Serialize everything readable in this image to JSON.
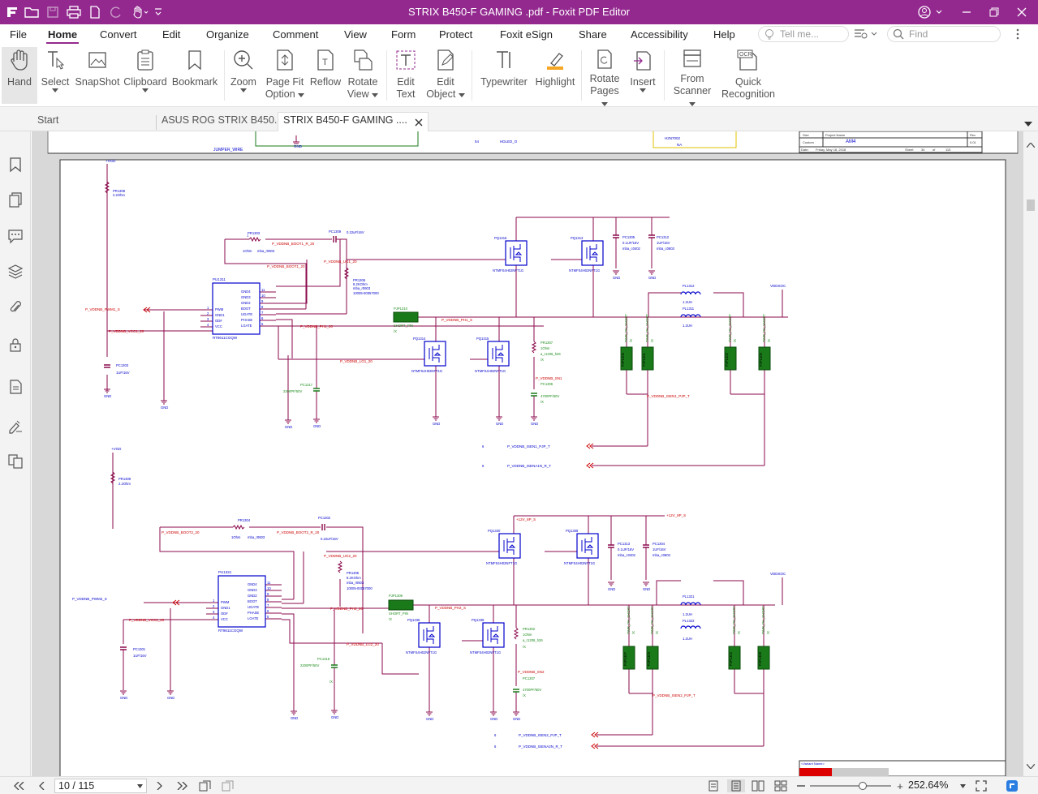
{
  "window": {
    "title": "STRIX B450-F GAMING .pdf - Foxit PDF Editor",
    "colors": {
      "brand": "#93298f",
      "wire": "#8b0a4b",
      "net_label": "#cc0000",
      "component": "#0000cc",
      "green_part": "#1a7a1a",
      "green_text": "#1e8c1e"
    }
  },
  "quick_access": {
    "icons": [
      "foxit-logo-icon",
      "open-folder-icon",
      "save-icon",
      "print-icon",
      "new-doc-icon",
      "undo-icon",
      "hand-tool-icon",
      "customize-icon"
    ]
  },
  "menu": {
    "items": [
      "File",
      "Home",
      "Convert",
      "Edit",
      "Organize",
      "Comment",
      "View",
      "Form",
      "Protect",
      "Foxit eSign",
      "Share",
      "Accessibility",
      "Help"
    ],
    "active": "Home",
    "tell_me_placeholder": "Tell me...",
    "find_placeholder": "Find"
  },
  "ribbon": {
    "hand": "Hand",
    "select": "Select",
    "snapshot": "SnapShot",
    "clipboard": "Clipboard",
    "bookmark": "Bookmark",
    "zoom": "Zoom",
    "page_fit_1": "Page Fit",
    "page_fit_2": "Option",
    "reflow": "Reflow",
    "rotate_view_1": "Rotate",
    "rotate_view_2": "View",
    "edit_text_1": "Edit",
    "edit_text_2": "Text",
    "edit_object_1": "Edit",
    "edit_object_2": "Object",
    "typewriter": "Typewriter",
    "highlight": "Highlight",
    "rotate_pages_1": "Rotate",
    "rotate_pages_2": "Pages",
    "insert": "Insert",
    "from_scanner_1": "From",
    "from_scanner_2": "Scanner",
    "quick_recognition_1": "Quick",
    "quick_recognition_2": "Recognition",
    "ocr_badge": "OCR"
  },
  "tabs": [
    {
      "label": "Start"
    },
    {
      "label": "ASUS ROG STRIX B450..."
    },
    {
      "label": "STRIX B450-F GAMING ...."
    }
  ],
  "status": {
    "page_value": "10 / 115",
    "zoom": "252.64%",
    "zoom_plus": "+"
  },
  "schematic": {
    "title_block": {
      "size": "Size",
      "project_name": "Project Name",
      "rev": "Rev",
      "custom": "Custom",
      "am4": "AM4",
      "rev_val": "0.01",
      "date_label": "Date:",
      "date": "Friday, May 18, 2018",
      "sheet": "Sheet",
      "sheet_num": "34",
      "of": "of",
      "total": "115"
    },
    "top_strip": {
      "jumper_wire": "JUMPER_WIRE",
      "gnd": "GND",
      "hdled": "HDLED_O",
      "num54": "54",
      "h2n": "H2N7002",
      "na": "NA"
    },
    "vgd": "+VGD",
    "gnd": "GND",
    "vddsoc": "VDDSOC",
    "p12v": "+12V_8P_S",
    "variant": "<Variant Name>",
    "upper": {
      "pr1308": "PR1308",
      "pr1308_v": "2.2Ohm",
      "pr1303": "PR1303",
      "pr1303_v": "1Ohm",
      "pr1303_p": "mba_r0603",
      "pc1309": "PC1309",
      "pc1309_v": "0.22uF/16V",
      "boot1": "P_VDDNB_BOOT1_R_20",
      "boot1b": "P_VDDNB_BOOT1_20",
      "ug1": "P_VDDNB_UG1_20",
      "pr1306": "PR1306",
      "pr1306_v": "8.2KOhm",
      "pr1306_p": "mba_r0603",
      "pr1306_n": "10005-00057000",
      "pu1311": "PU1311",
      "pu_part": "RT9611CGQW",
      "pins_l": [
        "PWM",
        "GND1",
        "OD#",
        "VCC"
      ],
      "pins_r": [
        "GND4",
        "GND3",
        "GND2",
        "BOOT",
        "UGATE",
        "PHASE",
        "LGATE"
      ],
      "pwm": "P_VDDNB_PWM1_S",
      "vcc": "P_VDDNB_VCC1_20",
      "ph1": "P_VDDNB_PH1_20",
      "pc1303": "PC1303",
      "pc1303_v": "1UF/16V",
      "lg1": "P_VDDNB_LG1_20",
      "pc1317": "PC1317",
      "pc1317_v": "2200PF/50V",
      "pjp1310": "PJP1310",
      "short_pin": "SHORT_PIN",
      "x": "/X",
      "ph1_s": "P_VDDNB_PH1_S",
      "pq1316": "PQ1316",
      "pq1313": "PQ1313",
      "pq1314": "PQ1314",
      "pq1315": "PQ1315",
      "mosfet": "NTMFS4H02NFT1G",
      "pc1305": "PC1305",
      "pc1305_v": "0.1UF/16V",
      "pc1305_p": "mba_c0402",
      "pc1312": "PC1312",
      "pc1312_v": "1UF/16V",
      "pc1312_p": "mba_c0603",
      "pl1312": "PL1312",
      "pl1311": "PL1311",
      "pl_v": "1.2UH",
      "pr1307": "PR1307",
      "pr1307_v": "1Ohm",
      "pr1307_p": "a_r1206_h26",
      "snb": "P_VDDNB_SN1",
      "pc1306": "PC1306",
      "pc1306_v": "4700PF/50V",
      "isen1": "P_VDDNB_ISEN1_PJP_T",
      "isen1_p": "P_VDDNB_ISEN1_PJP_T",
      "isena1n": "P_VDDNB_ISENA1N_R_T",
      "pjp1301": "PJP1301",
      "pjp1302": "PJP1302",
      "pjp1305": "PJP1305",
      "pjp1306": "PJP1306",
      "pwr_short": "PWR_PH_SHORT",
      "n6": "6"
    },
    "lower": {
      "pr1309": "PR1309",
      "pr1309_v": "2.2Ohm",
      "pr1304": "PR1304",
      "pr1304_v": "1Ohm",
      "pr1304_p": "mba_r0603",
      "pc1302": "PC1302",
      "pc1302_v": "0.22uF/16V",
      "boot2": "P_VDDNB_BOOT2_20",
      "boot2r": "P_VDDNB_BOOT2_R_20",
      "ug2": "P_VDDNB_UG2_20",
      "pr1305": "PR1305",
      "pr1305_v": "8.2KOhm",
      "pr1305_p": "mba_r0603",
      "pr1305_n": "10005-00057000",
      "pu1321": "PU1321",
      "pu_part": "RT9611CGQW",
      "pwm2": "P_VDDNB_PWM2_S",
      "vcc2": "P_VDDNB_VCC2_20",
      "ph2": "P_VDDNB_PH2_20",
      "pc1301": "PC1301",
      "pc1301_v": "1UF/16V",
      "lg2": "P_VDDNB_LG2_20",
      "pc1318": "PC1318",
      "pc1318_v": "2200PF/50V",
      "pjp1309": "PJP1309",
      "ph2_s": "P_VDDNB_PH2_S",
      "pq1320": "PQ1320",
      "pq1308": "PQ1308",
      "pq1336": "PQ1336",
      "pq1339": "PQ1339",
      "pc1313": "PC1313",
      "pc1313_v": "0.1UF/16V",
      "pc1313_p": "mba_c0402",
      "pc1304": "PC1304",
      "pc1304_v": "1UF/16V",
      "pc1304_p": "mba_c0603",
      "pl1321": "PL1321",
      "pl1322": "PL1322",
      "pr1302": "PR1302",
      "pr1302_v": "1Ohm",
      "pr1302_p": "a_r1206_h26",
      "sn2": "P_VDDNB_SN2",
      "pc1307": "PC1307",
      "pc1307_v": "4700PF/50V",
      "isen2": "P_VDDNB_ISEN2_PJP_T",
      "isen2_p": "P_VDDNB_ISEN2_PJP_T",
      "isena2n": "P_VDDNB_ISENA2N_R_T",
      "pjp1307": "PJP1307",
      "pjp1303": "PJP1303",
      "pjp1304": "PJP1304",
      "pjp1308": "PJP1308"
    }
  }
}
